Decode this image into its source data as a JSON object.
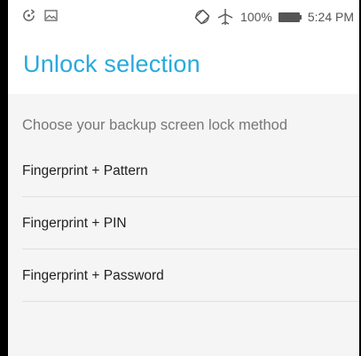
{
  "status_bar": {
    "battery_percent": "100%",
    "time": "5:24 PM",
    "icons": [
      "sync-icon",
      "image-icon",
      "rotate-icon",
      "airplane-mode-icon",
      "battery-icon"
    ]
  },
  "header": {
    "title": "Unlock selection"
  },
  "content": {
    "subtitle": "Choose your backup screen lock method",
    "options": [
      {
        "label": "Fingerprint + Pattern"
      },
      {
        "label": "Fingerprint + PIN"
      },
      {
        "label": "Fingerprint + Password"
      }
    ]
  },
  "colors": {
    "accent": "#29a9dd",
    "background": "#f5f5f5"
  }
}
